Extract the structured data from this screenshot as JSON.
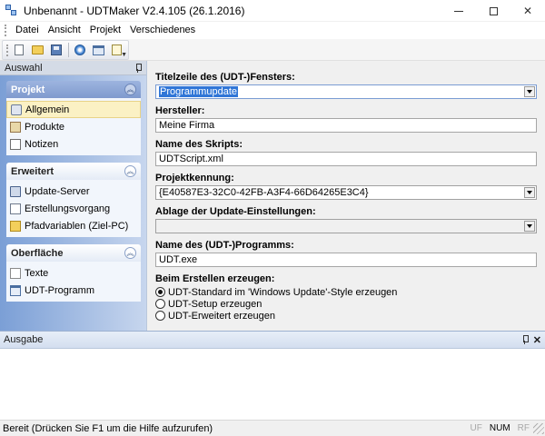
{
  "window": {
    "title": "Unbenannt - UDTMaker V2.4.105 (26.1.2016)",
    "minimize": "",
    "maximize": "",
    "close": "✕"
  },
  "menu": {
    "items": [
      "Datei",
      "Ansicht",
      "Projekt",
      "Verschiedenes"
    ]
  },
  "toolbar": {
    "buttons": [
      "new-icon",
      "open-folder-icon",
      "save-icon",
      "blue-orb-icon",
      "window-icon",
      "document-edit-icon"
    ],
    "overflow": "▼"
  },
  "sidebar": {
    "title": "Auswahl",
    "groups": [
      {
        "title": "Projekt",
        "toggle": "︽",
        "items": [
          {
            "label": "Allgemein",
            "icon": "gear-icon",
            "selected": true
          },
          {
            "label": "Produkte",
            "icon": "box-icon"
          },
          {
            "label": "Notizen",
            "icon": "note-icon"
          }
        ]
      },
      {
        "title": "Erweitert",
        "toggle": "︽",
        "items": [
          {
            "label": "Update-Server",
            "icon": "server-icon"
          },
          {
            "label": "Erstellungsvorgang",
            "icon": "process-icon"
          },
          {
            "label": "Pfadvariablen (Ziel-PC)",
            "icon": "folder-icon"
          }
        ]
      },
      {
        "title": "Oberfläche",
        "toggle": "︽",
        "items": [
          {
            "label": "Texte",
            "icon": "text-icon"
          },
          {
            "label": "UDT-Programm",
            "icon": "program-icon"
          }
        ]
      }
    ]
  },
  "form": {
    "window_title": {
      "label": "Titelzeile des (UDT-)Fensters:",
      "value": "Programmupdate"
    },
    "manufacturer": {
      "label": "Hersteller:",
      "value": "Meine Firma"
    },
    "script_name": {
      "label": "Name des Skripts:",
      "value": "UDTScript.xml"
    },
    "project_id": {
      "label": "Projektkennung:",
      "value": "{E40587E3-32C0-42FB-A3F4-66D64265E3C4}"
    },
    "settings_storage": {
      "label": "Ablage der Update-Einstellungen:",
      "value": ""
    },
    "program_name": {
      "label": "Name des (UDT-)Programms:",
      "value": "UDT.exe"
    },
    "create": {
      "label": "Beim Erstellen erzeugen:",
      "options": [
        {
          "label": "UDT-Standard im 'Windows Update'-Style erzeugen",
          "checked": true
        },
        {
          "label": "UDT-Setup erzeugen",
          "checked": false
        },
        {
          "label": "UDT-Erweitert erzeugen",
          "checked": false
        }
      ]
    }
  },
  "output": {
    "title": "Ausgabe",
    "pin": "⊥",
    "close": "✕"
  },
  "status": {
    "text": "Bereit (Drücken Sie F1 um die Hilfe aufzurufen)",
    "indicators": [
      {
        "label": "UF",
        "active": false
      },
      {
        "label": "NUM",
        "active": true
      },
      {
        "label": "RF",
        "active": false
      }
    ]
  }
}
